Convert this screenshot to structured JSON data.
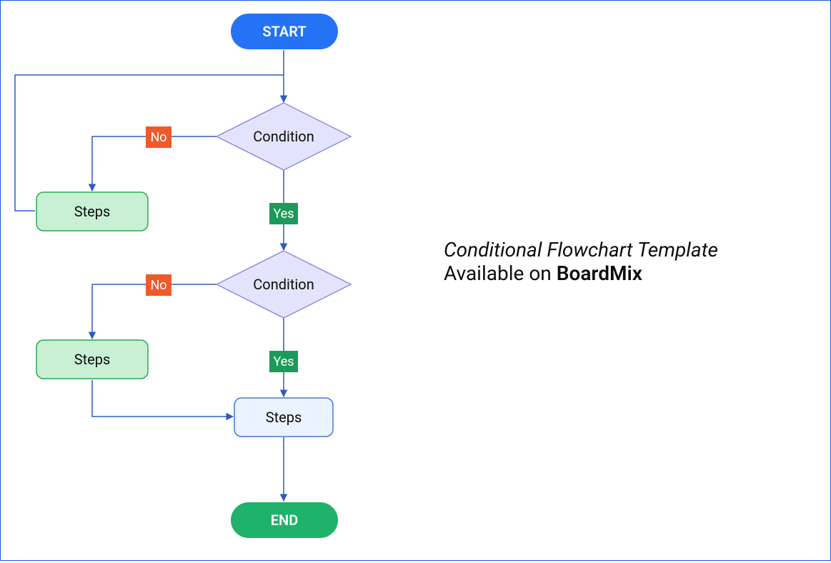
{
  "colors": {
    "start_fill": "#2572F4",
    "end_fill": "#1FB26B",
    "condition_fill": "#E3E3FB",
    "condition_stroke": "#8C8CE6",
    "steps_green_fill": "#C9F0D4",
    "steps_green_stroke": "#2CA85A",
    "steps_blue_fill": "#EBF2FF",
    "steps_blue_stroke": "#4A78CF",
    "line": "#2E5BBF",
    "no_fill": "#F05A2B",
    "yes_fill": "#1B9A59",
    "text_dark": "#0d0d0d",
    "text_white": "#ffffff"
  },
  "nodes": {
    "start": "START",
    "condition1": "Condition",
    "condition2": "Condition",
    "steps_left1": "Steps",
    "steps_left2": "Steps",
    "steps_center": "Steps",
    "end": "END"
  },
  "labels": {
    "yes1": "Yes",
    "yes2": "Yes",
    "no1": "No",
    "no2": "No"
  },
  "caption": {
    "line1": "Conditional Flowchart Template",
    "line2_pre": "Available on ",
    "line2_brand": "BoardMix"
  }
}
